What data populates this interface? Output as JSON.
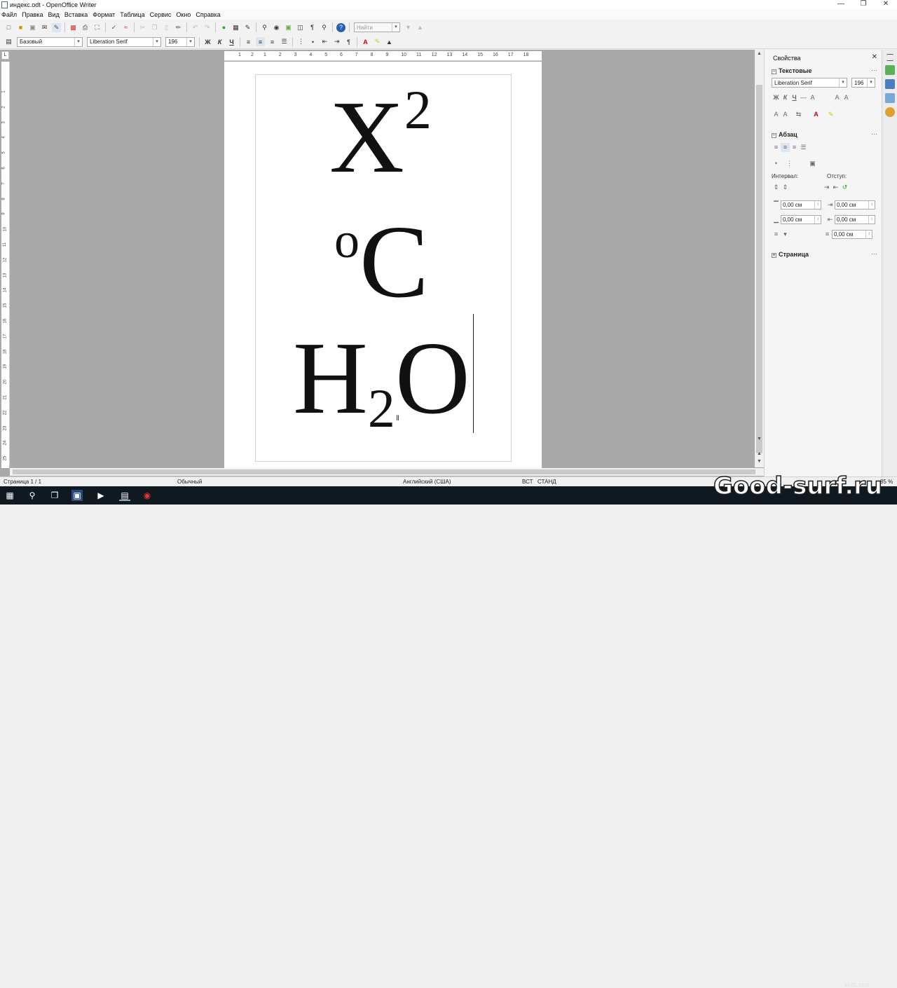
{
  "window": {
    "title": "индекс.odt - OpenOffice Writer"
  },
  "menu": [
    "Файл",
    "Правка",
    "Вид",
    "Вставка",
    "Формат",
    "Таблица",
    "Сервис",
    "Окно",
    "Справка"
  ],
  "toolbar": {
    "search_placeholder": "Найти",
    "paragraph_style": "Базовый",
    "font_name": "Liberation Serif",
    "font_size": "196",
    "bold": "Ж",
    "italic": "К",
    "underline": "Ч"
  },
  "ruler": {
    "h_labels": [
      "1",
      "2",
      "1",
      "2",
      "3",
      "4",
      "5",
      "6",
      "7",
      "8",
      "9",
      "10",
      "11",
      "12",
      "13",
      "14",
      "15",
      "16",
      "17",
      "18"
    ],
    "v_labels": [
      "1",
      "2",
      "3",
      "4",
      "5",
      "6",
      "7",
      "8",
      "9",
      "10",
      "11",
      "12",
      "13",
      "14",
      "15",
      "16",
      "17",
      "18",
      "19",
      "20",
      "21",
      "22",
      "23",
      "24",
      "25"
    ],
    "corner": "L"
  },
  "document": {
    "formula1_base": "X",
    "formula1_sup": "2",
    "formula2_sup": "o",
    "formula2_base": "C",
    "formula3_a": "H",
    "formula3_sub": "2",
    "formula3_b": "O"
  },
  "sidebar": {
    "title": "Свойства",
    "text_section": "Текстовые",
    "font_name": "Liberation Serif",
    "font_size": "196",
    "paragraph_section": "Абзац",
    "spacing_label": "Интервал:",
    "indent_label": "Отступ:",
    "above": "0,00 см",
    "below": "0,00 см",
    "indent_before": "0,00 см",
    "indent_after": "0,00 см",
    "first_line": "0,00 см",
    "page_section": "Страница"
  },
  "status": {
    "page": "Страница 1 / 1",
    "style": "Обычный",
    "language": "Английский (США)",
    "insert": "ВСТ",
    "select": "СТАНД",
    "zoom": "85 %"
  },
  "watermark": "Good-surf.ru",
  "tray": {
    "date": "16.01.2023"
  },
  "colors": {
    "workarea": "#a9a9a9",
    "taskbar": "#101820"
  }
}
